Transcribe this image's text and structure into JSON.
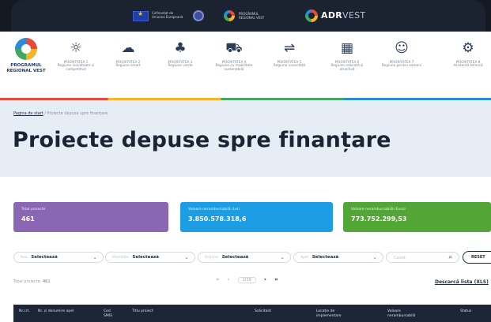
{
  "topbar": {
    "eu_text": "Cofinanțat de Uniunea Europeană",
    "program_text": "PROGRAMUL REGIONAL VEST",
    "adr_bold": "ADR",
    "adr_rest": "VEST"
  },
  "program": {
    "name": "PROGRAMUL REGIONAL VEST",
    "priorities": [
      {
        "title": "PRIORITATEA 1",
        "sub": "Regiune inovatoare și competitivă",
        "icon": "☼"
      },
      {
        "title": "PRIORITATEA 2",
        "sub": "Regiune smart",
        "icon": "☁"
      },
      {
        "title": "PRIORITATEA 3",
        "sub": "Regiune verde",
        "icon": "♣"
      },
      {
        "title": "PRIORITATEA 4",
        "sub": "Regiune cu mobilitate sustenabilă",
        "icon": "⛟"
      },
      {
        "title": "PRIORITATEA 5",
        "sub": "Regiune conectată",
        "icon": "⇌"
      },
      {
        "title": "PRIORITATEA 6",
        "sub": "Regiune educată și atractivă",
        "icon": "▦"
      },
      {
        "title": "PRIORITATEA 7",
        "sub": "Regiune pentru oameni",
        "icon": "☺"
      },
      {
        "title": "PRIORITATEA 8",
        "sub": "Asistență tehnică",
        "icon": "⚙"
      }
    ]
  },
  "breadcrumb": {
    "home": "Pagina de start",
    "separator": "/",
    "current": "Proiecte depuse spre finanțare"
  },
  "page_title": "Proiecte depuse spre finanțare",
  "stats": [
    {
      "label": "Total proiecte",
      "value": "461",
      "color": "#8a66b3"
    },
    {
      "label": "Valoare nerambursabilă (Lei)",
      "value": "3.850.578.318,6",
      "color": "#1c9de4"
    },
    {
      "label": "Valoare nerambursabilă (Euro)",
      "value": "773.752.299,53",
      "color": "#52a635"
    }
  ],
  "filters": [
    {
      "label": "Axa",
      "value": "Selectează"
    },
    {
      "label": "Prioritate",
      "value": "Selectează"
    },
    {
      "label": "Acțiune",
      "value": "Selectează"
    },
    {
      "label": "Apel",
      "value": "Selectează"
    }
  ],
  "search": {
    "placeholder": "Caută"
  },
  "reset_label": "RESET",
  "total": {
    "label": "Total proiecte:",
    "value": "461"
  },
  "pager": {
    "first": "«",
    "prev": "‹",
    "current": "1/39",
    "next": "›",
    "last": "»"
  },
  "download_label": "Descarcă lista (XLS)",
  "table_headers": [
    "Nr.crt.",
    "Nr. și denumire apel",
    "Cod SMIS",
    "Titlu proiect",
    "Solicitant",
    "Locație de implementare",
    "Valoare nerambursabilă",
    "Status"
  ]
}
